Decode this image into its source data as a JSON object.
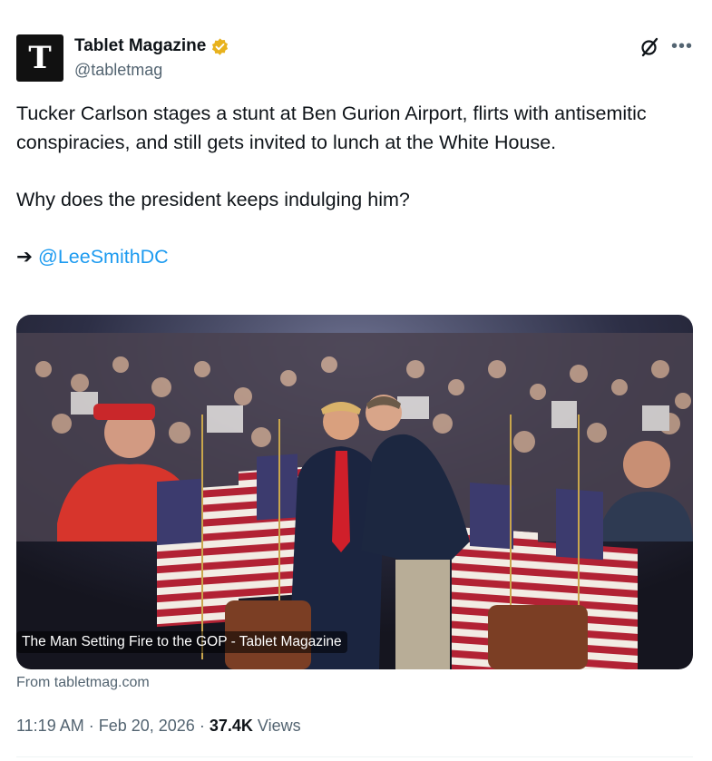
{
  "author": {
    "display_name": "Tablet Magazine",
    "handle": "@tabletmag",
    "avatar_letter": "T",
    "verified_color": "#e8b21d"
  },
  "tweet": {
    "line1": "Tucker Carlson stages a stunt at Ben Gurion Airport, flirts with antisemitic conspiracies, and still gets invited to lunch at the White House.",
    "line2": "Why does the president keeps indulging him?",
    "arrow": "➔ ",
    "mention": "@LeeSmithDC"
  },
  "card": {
    "title": "The Man Setting Fire to the GOP - Tablet Magazine",
    "source": "From tabletmag.com"
  },
  "meta": {
    "time": "11:19 AM",
    "date": "Feb 20, 2026",
    "views_count": "37.4K",
    "views_label": "Views"
  },
  "icons": {
    "grok": "grok-slash-icon",
    "more": "more-horizontal-icon"
  },
  "colors": {
    "link": "#1d9bf0",
    "secondary_text": "#536471",
    "flag_red": "#b22234",
    "flag_blue": "#3c3b6e"
  }
}
